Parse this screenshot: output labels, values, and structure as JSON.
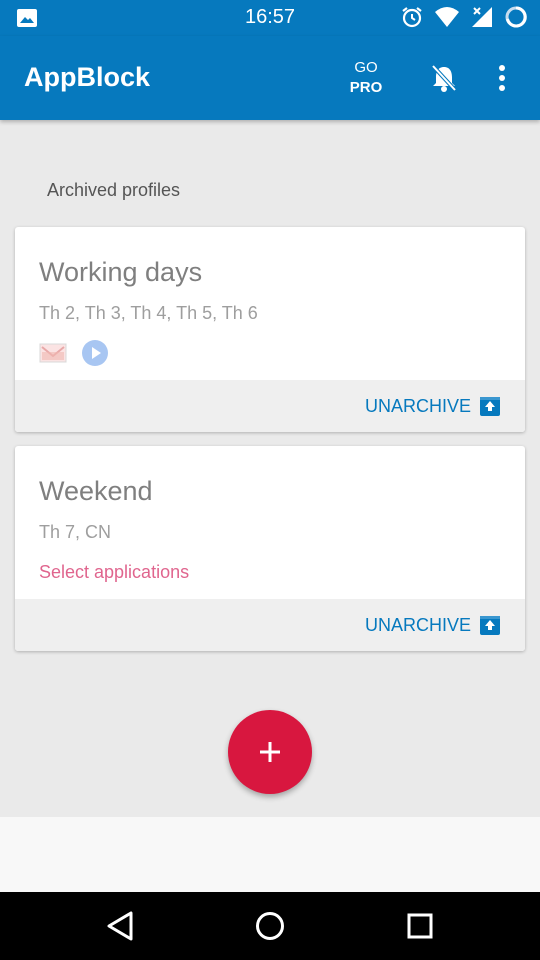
{
  "status_bar": {
    "time": "16:57",
    "icons": [
      "gallery-icon",
      "alarm-icon",
      "wifi-icon",
      "signal-icon",
      "battery-icon"
    ]
  },
  "app_bar": {
    "title": "AppBlock",
    "go_label": "GO",
    "pro_label": "PRO",
    "icons": [
      "bell-off-icon",
      "more-vert-icon"
    ]
  },
  "section_label": "Archived profiles",
  "profiles": [
    {
      "name": "Working days",
      "days": "Th 2, Th 3, Th 4, Th 5, Th 6",
      "app_icons": [
        "mail-app-icon",
        "play-app-icon"
      ],
      "action_label": "UNARCHIVE"
    },
    {
      "name": "Weekend",
      "days": "Th 7, CN",
      "select_label": "Select applications",
      "action_label": "UNARCHIVE"
    }
  ],
  "fab": {
    "icon": "plus-icon"
  },
  "nav_bar": {
    "icons": [
      "back-icon",
      "home-icon",
      "recents-icon"
    ]
  },
  "colors": {
    "primary": "#0679be",
    "accent": "#d8173f",
    "select_link": "#e0658e",
    "background": "#eaeaea"
  }
}
